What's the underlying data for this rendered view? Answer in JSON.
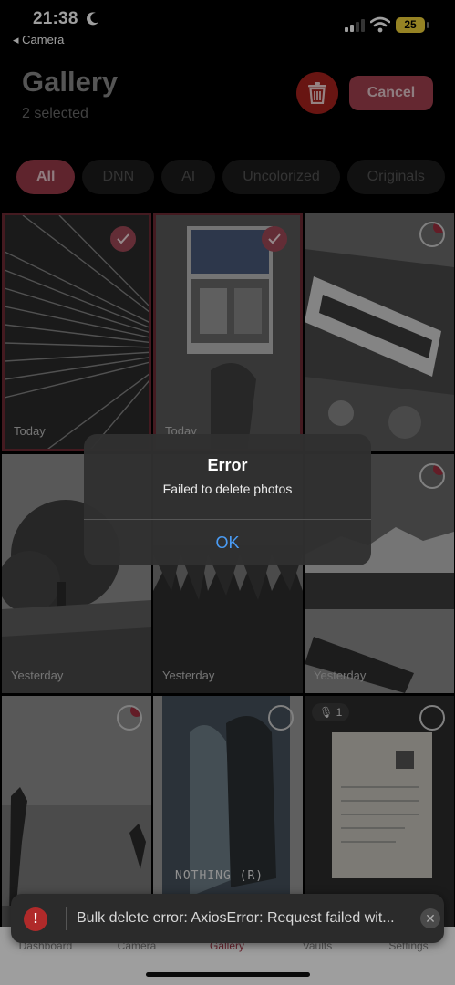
{
  "status_bar": {
    "time": "21:38",
    "back_app": "◂ Camera",
    "battery": "25"
  },
  "header": {
    "title": "Gallery",
    "subtitle": "2 selected",
    "cancel_label": "Cancel"
  },
  "filters": [
    {
      "label": "All",
      "active": true
    },
    {
      "label": "DNN",
      "active": false
    },
    {
      "label": "AI",
      "active": false
    },
    {
      "label": "Uncolorized",
      "active": false
    },
    {
      "label": "Originals",
      "active": false
    }
  ],
  "photos": [
    {
      "date": "Today",
      "selected": true
    },
    {
      "date": "Today",
      "selected": true
    },
    {
      "date": "",
      "selected": false
    },
    {
      "date": "Yesterday",
      "selected": false
    },
    {
      "date": "Yesterday",
      "selected": false
    },
    {
      "date": "Yesterday",
      "selected": false
    },
    {
      "date": "",
      "selected": false
    },
    {
      "date": "",
      "selected": false,
      "caption": "NOTHING (R)"
    },
    {
      "date": "",
      "selected": false,
      "audio_count": "1"
    }
  ],
  "alert": {
    "title": "Error",
    "message": "Failed to delete photos",
    "ok_label": "OK"
  },
  "toast": {
    "message": "Bulk delete error: AxiosError: Request failed wit..."
  },
  "tabbar": {
    "items": [
      {
        "label": "Dashboard",
        "active": false
      },
      {
        "label": "Camera",
        "active": false
      },
      {
        "label": "Gallery",
        "active": true
      },
      {
        "label": "Vaults",
        "active": false
      },
      {
        "label": "Settings",
        "active": false
      }
    ]
  },
  "colors": {
    "accent": "#9a3b4a",
    "delete": "#a8231e",
    "link_blue": "#4a9cf5",
    "error": "#b02a2a"
  }
}
